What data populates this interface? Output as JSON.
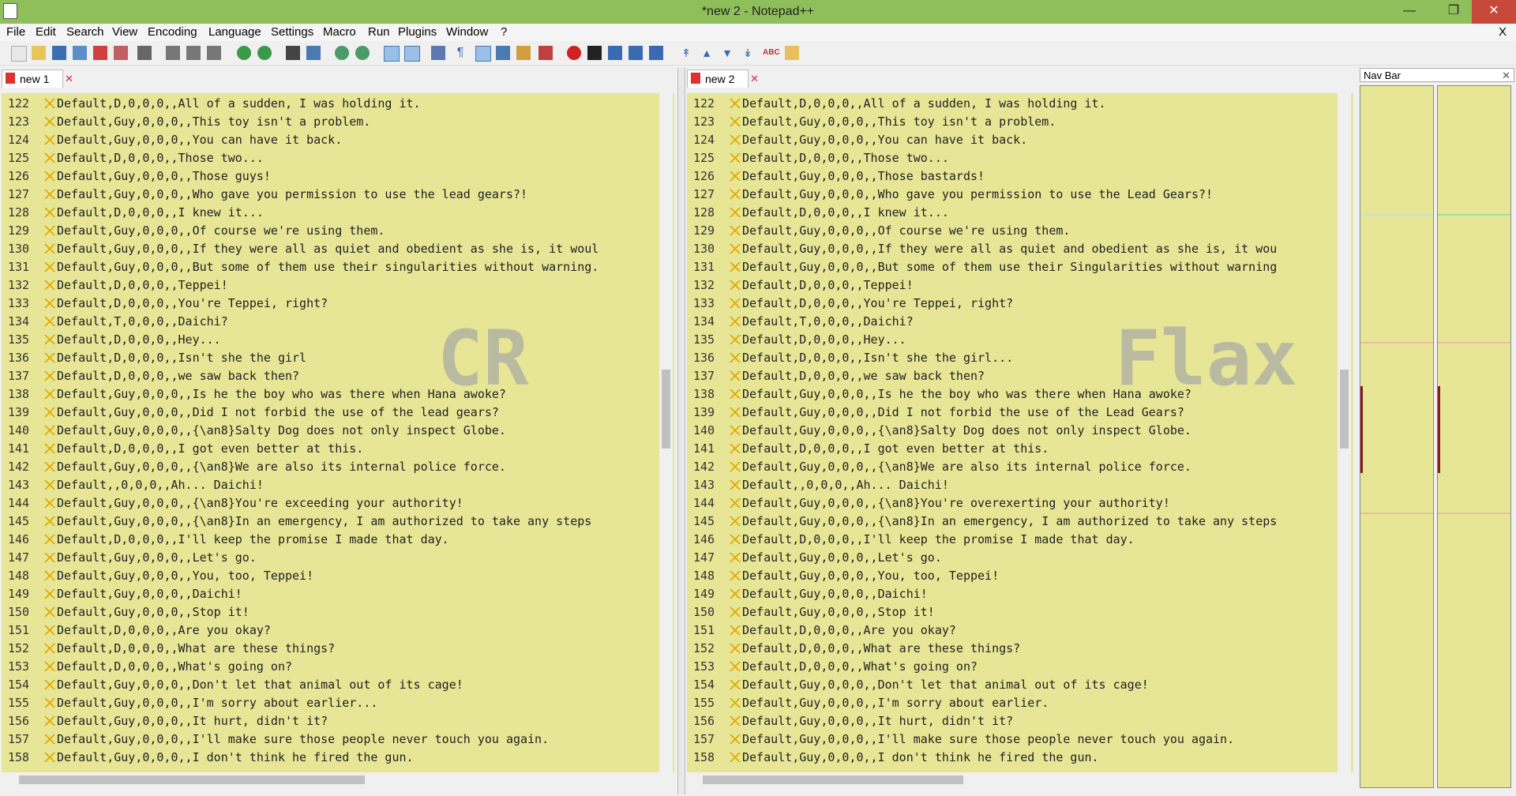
{
  "window": {
    "title": "*new  2 - Notepad++"
  },
  "menu": [
    "File",
    "Edit",
    "Search",
    "View",
    "Encoding",
    "Language",
    "Settings",
    "Macro",
    "Run",
    "Plugins",
    "Window",
    "?"
  ],
  "menu_close": "X",
  "left_tab": {
    "label": "new 1",
    "close": "✕"
  },
  "right_tab": {
    "label": "new 2",
    "close": "✕"
  },
  "navbar": {
    "title": "Nav Bar",
    "close": "✕"
  },
  "left_watermark": "CR",
  "right_watermark": "Flax",
  "left_lines": [
    {
      "n": "122",
      "t": "Default,D,0,0,0,,All of a sudden, I was holding it."
    },
    {
      "n": "123",
      "t": "Default,Guy,0,0,0,,This toy isn't a problem."
    },
    {
      "n": "124",
      "t": "Default,Guy,0,0,0,,You can have it back."
    },
    {
      "n": "125",
      "t": "Default,D,0,0,0,,Those two..."
    },
    {
      "n": "126",
      "t": "Default,Guy,0,0,0,,Those guys!"
    },
    {
      "n": "127",
      "t": "Default,Guy,0,0,0,,Who gave you permission to use the lead gears?!"
    },
    {
      "n": "128",
      "t": "Default,D,0,0,0,,I knew it..."
    },
    {
      "n": "129",
      "t": "Default,Guy,0,0,0,,Of course we're using them."
    },
    {
      "n": "130",
      "t": "Default,Guy,0,0,0,,If they were all as quiet and obedient as she is, it woul"
    },
    {
      "n": "131",
      "t": "Default,Guy,0,0,0,,But some of them use their singularities without warning."
    },
    {
      "n": "132",
      "t": "Default,D,0,0,0,,Teppei!"
    },
    {
      "n": "133",
      "t": "Default,D,0,0,0,,You're Teppei, right?"
    },
    {
      "n": "134",
      "t": "Default,T,0,0,0,,Daichi?"
    },
    {
      "n": "135",
      "t": "Default,D,0,0,0,,Hey..."
    },
    {
      "n": "136",
      "t": "Default,D,0,0,0,,Isn't she the girl"
    },
    {
      "n": "137",
      "t": "Default,D,0,0,0,,we saw back then?"
    },
    {
      "n": "138",
      "t": "Default,Guy,0,0,0,,Is he the boy who was there when Hana awoke?"
    },
    {
      "n": "139",
      "t": "Default,Guy,0,0,0,,Did I not forbid the use of the lead gears?"
    },
    {
      "n": "140",
      "t": "Default,Guy,0,0,0,,{\\an8}Salty Dog does not only inspect Globe."
    },
    {
      "n": "141",
      "t": "Default,D,0,0,0,,I got even better at this."
    },
    {
      "n": "142",
      "t": "Default,Guy,0,0,0,,{\\an8}We are also its internal police force."
    },
    {
      "n": "143",
      "t": "Default,,0,0,0,,Ah... Daichi!"
    },
    {
      "n": "144",
      "t": "Default,Guy,0,0,0,,{\\an8}You're exceeding your authority!"
    },
    {
      "n": "145",
      "t": "Default,Guy,0,0,0,,{\\an8}In an emergency, I am authorized to take any steps"
    },
    {
      "n": "146",
      "t": "Default,D,0,0,0,,I'll keep the promise I made that day."
    },
    {
      "n": "147",
      "t": "Default,Guy,0,0,0,,Let's go."
    },
    {
      "n": "148",
      "t": "Default,Guy,0,0,0,,You, too, Teppei!"
    },
    {
      "n": "149",
      "t": "Default,Guy,0,0,0,,Daichi!"
    },
    {
      "n": "150",
      "t": "Default,Guy,0,0,0,,Stop it!"
    },
    {
      "n": "151",
      "t": "Default,D,0,0,0,,Are you okay?"
    },
    {
      "n": "152",
      "t": "Default,D,0,0,0,,What are these things?"
    },
    {
      "n": "153",
      "t": "Default,D,0,0,0,,What's going on?"
    },
    {
      "n": "154",
      "t": "Default,Guy,0,0,0,,Don't let that animal out of its cage!"
    },
    {
      "n": "155",
      "t": "Default,Guy,0,0,0,,I'm sorry about earlier..."
    },
    {
      "n": "156",
      "t": "Default,Guy,0,0,0,,It hurt, didn't it?"
    },
    {
      "n": "157",
      "t": "Default,Guy,0,0,0,,I'll make sure those people never touch you again."
    },
    {
      "n": "158",
      "t": "Default,Guy,0,0,0,,I don't think he fired the gun."
    }
  ],
  "right_lines": [
    {
      "n": "122",
      "t": "Default,D,0,0,0,,All of a sudden, I was holding it."
    },
    {
      "n": "123",
      "t": "Default,Guy,0,0,0,,This toy isn't a problem."
    },
    {
      "n": "124",
      "t": "Default,Guy,0,0,0,,You can have it back."
    },
    {
      "n": "125",
      "t": "Default,D,0,0,0,,Those two..."
    },
    {
      "n": "126",
      "t": "Default,Guy,0,0,0,,Those bastards!"
    },
    {
      "n": "127",
      "t": "Default,Guy,0,0,0,,Who gave you permission to use the Lead Gears?!"
    },
    {
      "n": "128",
      "t": "Default,D,0,0,0,,I knew it..."
    },
    {
      "n": "129",
      "t": "Default,Guy,0,0,0,,Of course we're using them."
    },
    {
      "n": "130",
      "t": "Default,Guy,0,0,0,,If they were all as quiet and obedient as she is, it wou"
    },
    {
      "n": "131",
      "t": "Default,Guy,0,0,0,,But some of them use their Singularities without warning"
    },
    {
      "n": "132",
      "t": "Default,D,0,0,0,,Teppei!"
    },
    {
      "n": "133",
      "t": "Default,D,0,0,0,,You're Teppei, right?"
    },
    {
      "n": "134",
      "t": "Default,T,0,0,0,,Daichi?"
    },
    {
      "n": "135",
      "t": "Default,D,0,0,0,,Hey..."
    },
    {
      "n": "136",
      "t": "Default,D,0,0,0,,Isn't she the girl..."
    },
    {
      "n": "137",
      "t": "Default,D,0,0,0,,we saw back then?"
    },
    {
      "n": "138",
      "t": "Default,Guy,0,0,0,,Is he the boy who was there when Hana awoke?"
    },
    {
      "n": "139",
      "t": "Default,Guy,0,0,0,,Did I not forbid the use of the Lead Gears?"
    },
    {
      "n": "140",
      "t": "Default,Guy,0,0,0,,{\\an8}Salty Dog does not only inspect Globe."
    },
    {
      "n": "141",
      "t": "Default,D,0,0,0,,I got even better at this."
    },
    {
      "n": "142",
      "t": "Default,Guy,0,0,0,,{\\an8}We are also its internal police force."
    },
    {
      "n": "143",
      "t": "Default,,0,0,0,,Ah... Daichi!"
    },
    {
      "n": "144",
      "t": "Default,Guy,0,0,0,,{\\an8}You're overexerting your authority!"
    },
    {
      "n": "145",
      "t": "Default,Guy,0,0,0,,{\\an8}In an emergency, I am authorized to take any steps"
    },
    {
      "n": "146",
      "t": "Default,D,0,0,0,,I'll keep the promise I made that day."
    },
    {
      "n": "147",
      "t": "Default,Guy,0,0,0,,Let's go."
    },
    {
      "n": "148",
      "t": "Default,Guy,0,0,0,,You, too, Teppei!"
    },
    {
      "n": "149",
      "t": "Default,Guy,0,0,0,,Daichi!"
    },
    {
      "n": "150",
      "t": "Default,Guy,0,0,0,,Stop it!"
    },
    {
      "n": "151",
      "t": "Default,D,0,0,0,,Are you okay?"
    },
    {
      "n": "152",
      "t": "Default,D,0,0,0,,What are these things?"
    },
    {
      "n": "153",
      "t": "Default,D,0,0,0,,What's going on?"
    },
    {
      "n": "154",
      "t": "Default,Guy,0,0,0,,Don't let that animal out of its cage!"
    },
    {
      "n": "155",
      "t": "Default,Guy,0,0,0,,I'm sorry about earlier."
    },
    {
      "n": "156",
      "t": "Default,Guy,0,0,0,,It hurt, didn't it?"
    },
    {
      "n": "157",
      "t": "Default,Guy,0,0,0,,I'll make sure those people never touch you again."
    },
    {
      "n": "158",
      "t": "Default,Guy,0,0,0,,I don't think he fired the gun."
    }
  ],
  "colors": {
    "editor_bg": "#e6e696",
    "title_bg": "#8fbf5a",
    "diff_mark": "#8b1a1a"
  }
}
